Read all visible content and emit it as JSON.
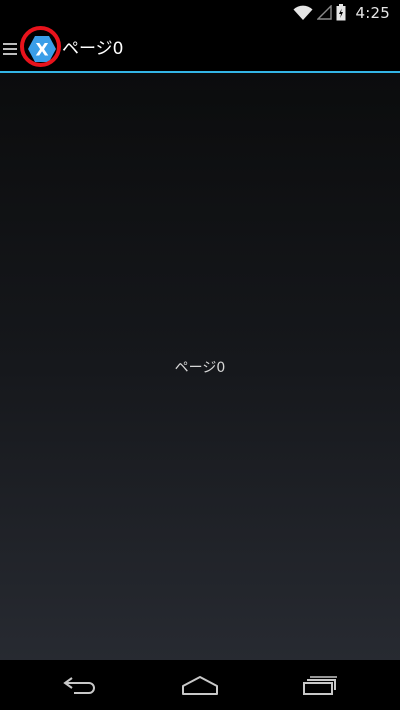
{
  "status_bar": {
    "time": "4:25",
    "icons": [
      "wifi-icon",
      "signal-icon",
      "battery-icon"
    ]
  },
  "action_bar": {
    "title": "ページ0",
    "drawer_icon": "menu-icon",
    "app_icon": "xamarin-logo-icon",
    "logo_letter": "X",
    "highlight_color": "#e8131c",
    "divider_color": "#33b5e5"
  },
  "content": {
    "label": "ページ0"
  },
  "nav_bar": {
    "buttons": [
      "back-icon",
      "home-icon",
      "recents-icon"
    ]
  }
}
